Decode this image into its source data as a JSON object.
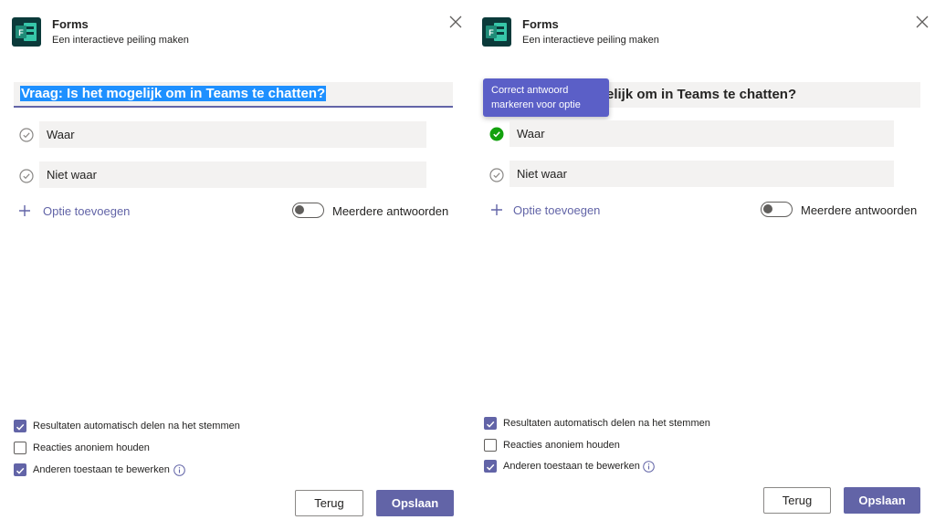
{
  "colors": {
    "accent": "#6264a7",
    "correct": "#13a10e",
    "selection": "#1e90ff"
  },
  "left": {
    "app_title": "Forms",
    "app_subtitle": "Een interactieve peiling maken",
    "question": "Vraag: Is het mogelijk om in Teams te chatten?",
    "options": [
      {
        "label": "Waar",
        "correct": false
      },
      {
        "label": "Niet waar",
        "correct": false
      }
    ],
    "add_option": "Optie toevoegen",
    "multiple_answers": "Meerdere antwoorden",
    "settings": [
      {
        "label": "Resultaten automatisch delen na het stemmen",
        "checked": true
      },
      {
        "label": "Reacties anoniem houden",
        "checked": false
      },
      {
        "label": "Anderen toestaan te bewerken",
        "checked": true
      }
    ],
    "back": "Terug",
    "save": "Opslaan"
  },
  "right": {
    "app_title": "Forms",
    "app_subtitle": "Een interactieve peiling maken",
    "question_visible": "elijk om in Teams te chatten?",
    "tooltip": "Correct antwoord markeren voor optie",
    "options": [
      {
        "label": "Waar",
        "correct": true
      },
      {
        "label": "Niet waar",
        "correct": false
      }
    ],
    "add_option": "Optie toevoegen",
    "multiple_answers": "Meerdere antwoorden",
    "settings": [
      {
        "label": "Resultaten automatisch delen na het stemmen",
        "checked": true
      },
      {
        "label": "Reacties anoniem houden",
        "checked": false
      },
      {
        "label": "Anderen toestaan te bewerken",
        "checked": true
      }
    ],
    "back": "Terug",
    "save": "Opslaan"
  }
}
